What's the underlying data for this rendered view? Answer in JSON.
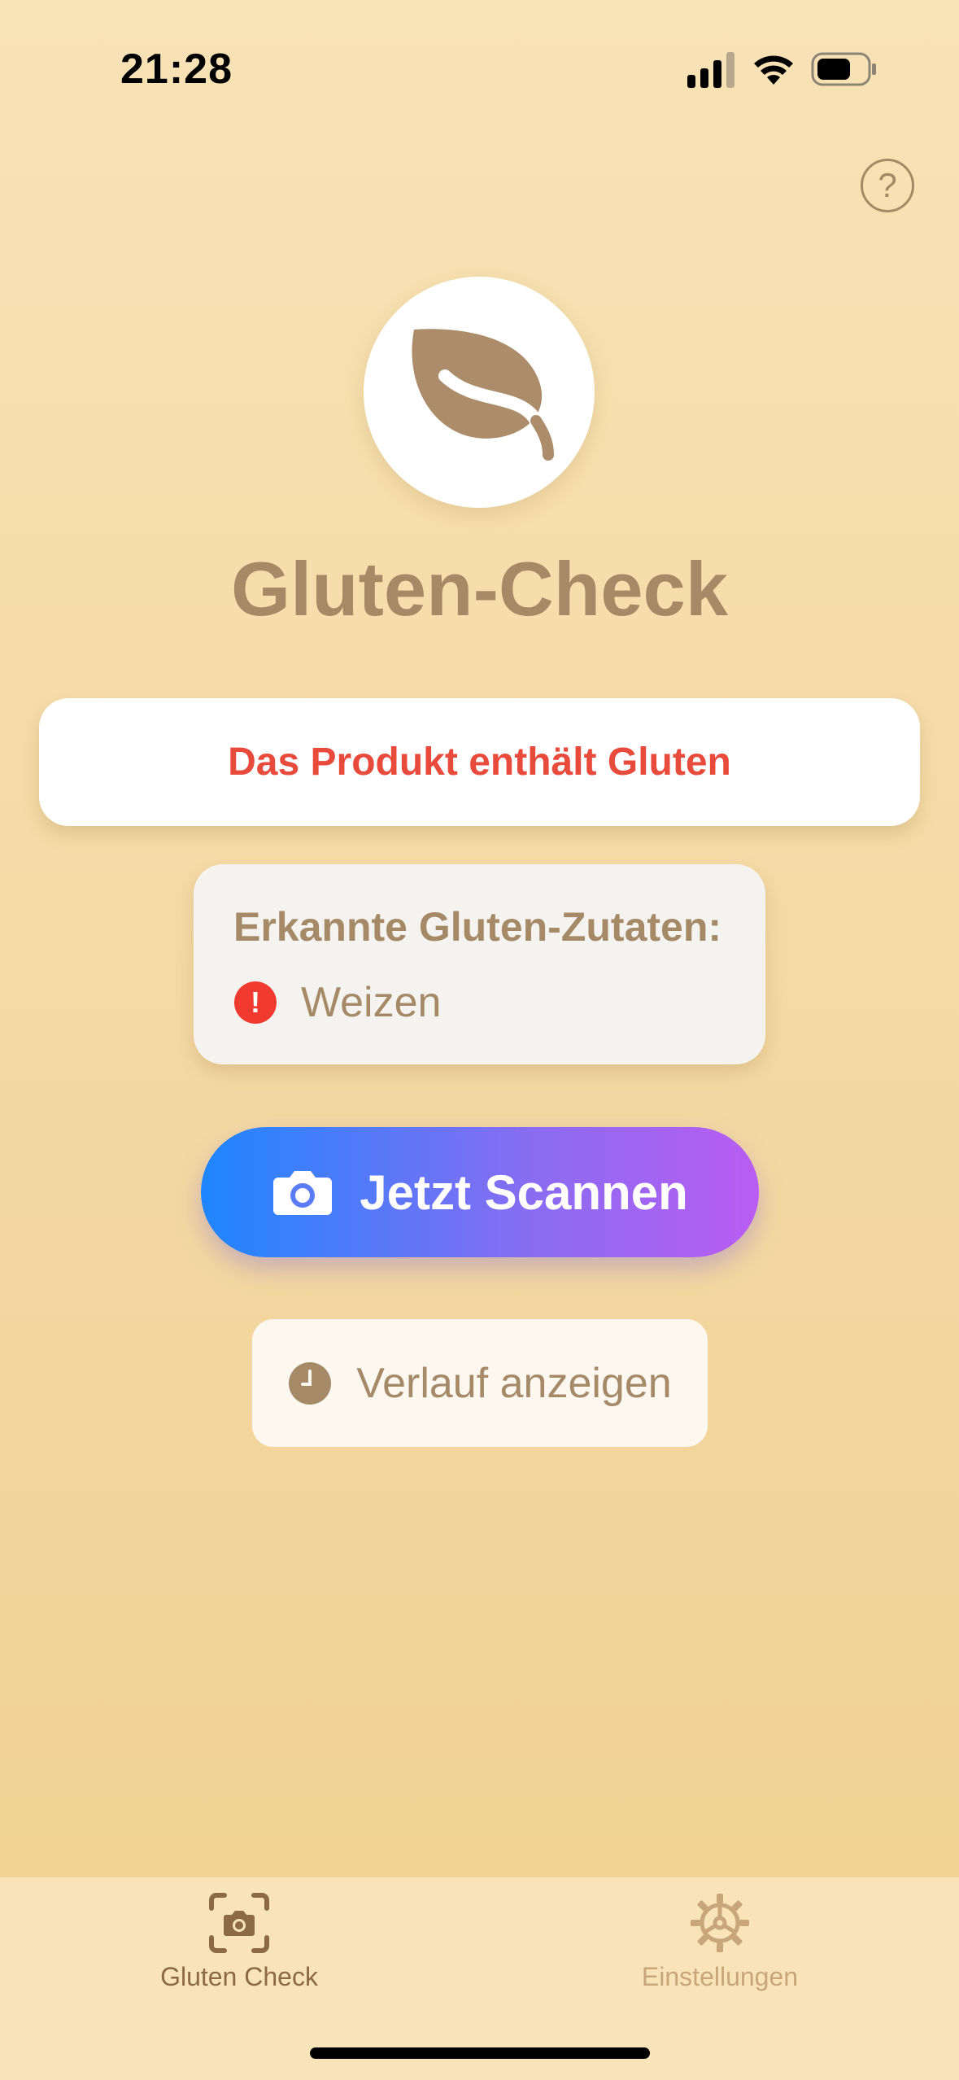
{
  "status_bar": {
    "time": "21:28"
  },
  "header": {
    "help_icon": "question-circle-icon",
    "help_glyph": "?"
  },
  "logo": {
    "icon": "leaf-icon"
  },
  "app": {
    "title": "Gluten-Check"
  },
  "result": {
    "message": "Das Produkt enthält Gluten",
    "color": "#E84A3C"
  },
  "ingredients": {
    "title": "Erkannte Gluten-Zutaten:",
    "items": [
      {
        "icon": "exclamation-circle-icon",
        "glyph": "!",
        "label": "Weizen"
      }
    ]
  },
  "actions": {
    "scan_label": "Jetzt Scannen",
    "history_label": "Verlauf anzeigen"
  },
  "tab_bar": {
    "tabs": [
      {
        "label": "Gluten Check",
        "icon": "camera-viewfinder-icon",
        "active": true
      },
      {
        "label": "Einstellungen",
        "icon": "gear-icon",
        "active": false
      }
    ]
  },
  "colors": {
    "accent": "#A68A68",
    "scan_gradient_start": "#1E86FF",
    "scan_gradient_end": "#B95CF2",
    "alert": "#F03A30"
  }
}
